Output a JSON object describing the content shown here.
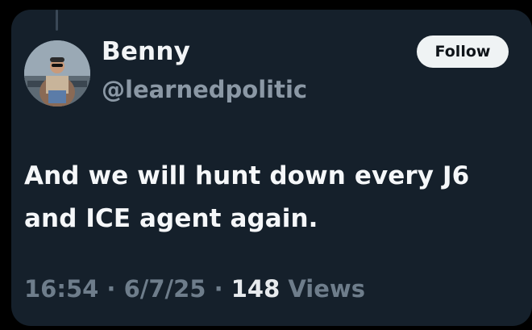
{
  "post": {
    "author": {
      "name": "Benny",
      "handle": "@learnedpolitic"
    },
    "follow_label": "Follow",
    "text_lines": [
      "And we will hunt down every J6",
      "and ICE agent again."
    ],
    "meta": {
      "time": "16:54",
      "date": "6/7/25",
      "separator": "·",
      "views_count": "148",
      "views_label": "Views"
    }
  },
  "colors": {
    "background": "#15202b",
    "primary_text": "#f5f7f9",
    "secondary_text": "#8b98a5",
    "follow_button_bg": "#eff3f4"
  }
}
